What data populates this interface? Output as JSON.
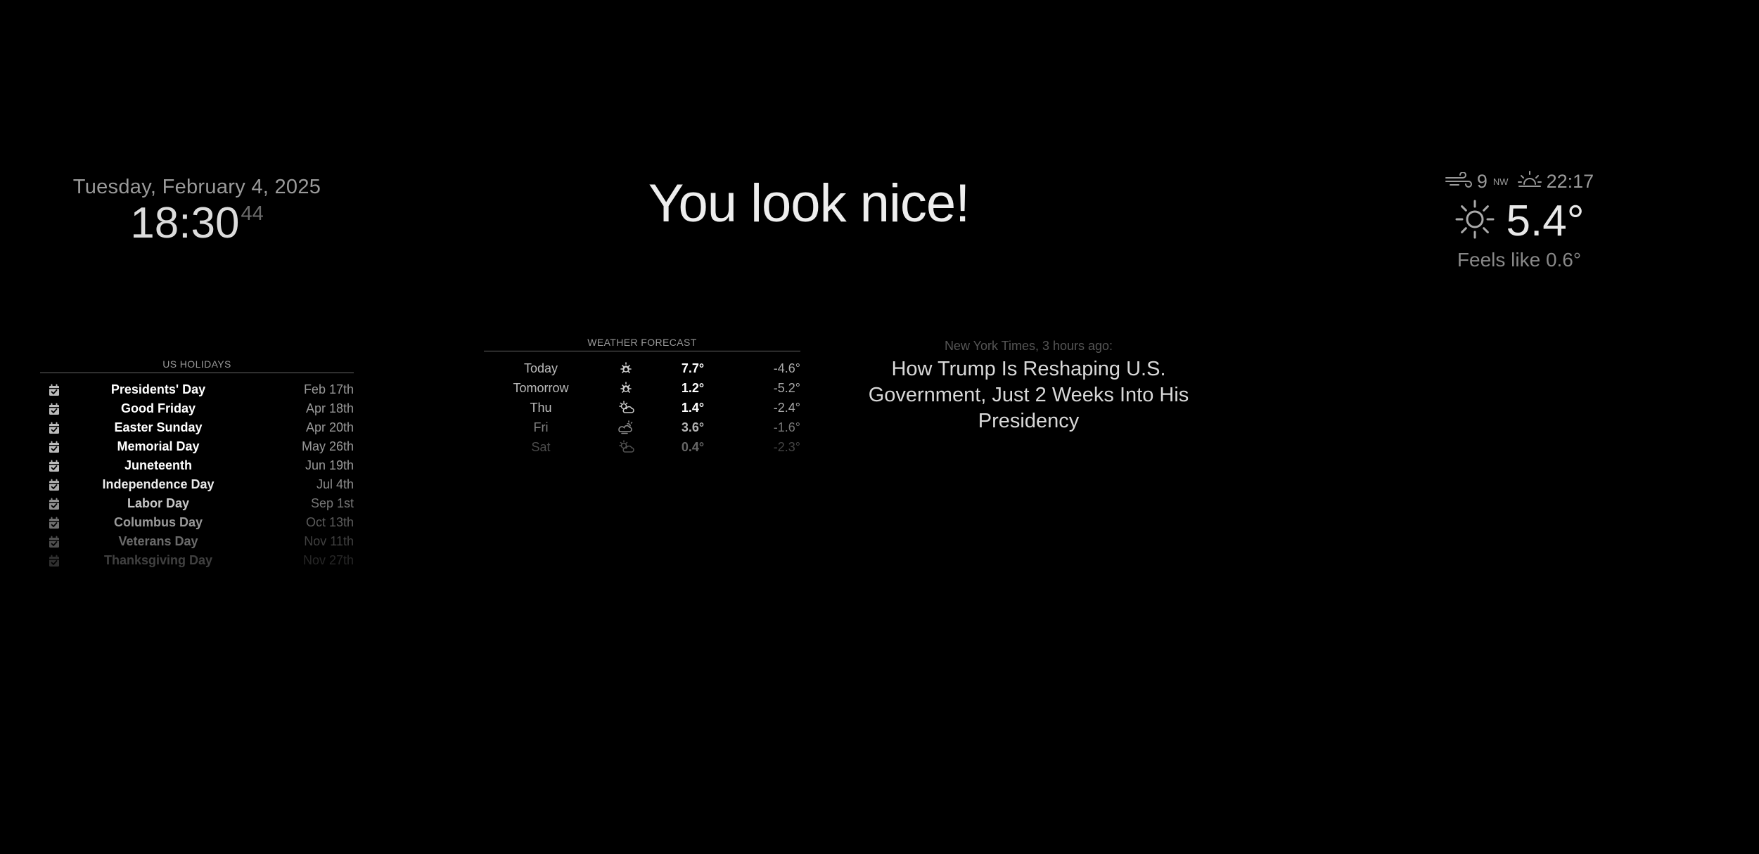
{
  "clock": {
    "date": "Tuesday, February 4, 2025",
    "time": "18:30",
    "seconds": "44"
  },
  "compliment": {
    "text": "You look nice!"
  },
  "current_weather": {
    "wind_icon": "wind-icon",
    "wind_speed": "9",
    "wind_direction": "NW",
    "sunset_icon": "sunset-icon",
    "sunset_time": "22:17",
    "condition_icon": "sun-icon",
    "temperature": "5.4°",
    "feels_like": "Feels like 0.6°"
  },
  "holidays": {
    "header": "US Holidays",
    "icon": "calendar-check-icon",
    "items": [
      {
        "title": "Presidents' Day",
        "date": "Feb 17th"
      },
      {
        "title": "Good Friday",
        "date": "Apr 18th"
      },
      {
        "title": "Easter Sunday",
        "date": "Apr 20th"
      },
      {
        "title": "Memorial Day",
        "date": "May 26th"
      },
      {
        "title": "Juneteenth",
        "date": "Jun 19th"
      },
      {
        "title": "Independence Day",
        "date": "Jul 4th"
      },
      {
        "title": "Labor Day",
        "date": "Sep 1st"
      },
      {
        "title": "Columbus Day",
        "date": "Oct 13th"
      },
      {
        "title": "Veterans Day",
        "date": "Nov 11th"
      },
      {
        "title": "Thanksgiving Day",
        "date": "Nov 27th"
      }
    ]
  },
  "forecast": {
    "header": "Weather Forecast",
    "days": [
      {
        "day": "Today",
        "icon": "sun-icon",
        "max": "7.7°",
        "min": "-4.6°"
      },
      {
        "day": "Tomorrow",
        "icon": "sun-icon",
        "max": "1.2°",
        "min": "-5.2°"
      },
      {
        "day": "Thu",
        "icon": "partly-cloudy-icon",
        "max": "1.4°",
        "min": "-2.4°"
      },
      {
        "day": "Fri",
        "icon": "cloudy-sun-icon",
        "max": "3.6°",
        "min": "-1.6°"
      },
      {
        "day": "Sat",
        "icon": "partly-cloudy-icon",
        "max": "0.4°",
        "min": "-2.3°"
      }
    ]
  },
  "news": {
    "source": "New York Times, 3 hours ago:",
    "headline": "How Trump Is Reshaping U.S. Government, Just 2 Weeks Into His Presidency"
  }
}
